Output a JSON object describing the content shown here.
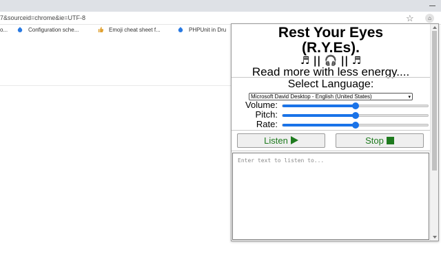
{
  "browser": {
    "url": "7&sourceid=chrome&ie=UTF-8",
    "bookmarks": [
      {
        "label": "o..."
      },
      {
        "label": "Configuration sche..."
      },
      {
        "label": "Emoji cheat sheet f..."
      },
      {
        "label": "PHPUnit in Dru"
      }
    ]
  },
  "popup": {
    "title_line1": "Rest Your Eyes",
    "title_line2": "(R.Y.Es).",
    "music_notes": "♬ || 🎧 || ♬",
    "tagline": "Read more with less energy....",
    "language_label": "Select Language:",
    "voice_selected": "Microsoft David Desktop - English (United States)",
    "sliders": [
      {
        "label": "Volume:",
        "value": 0.5
      },
      {
        "label": "Pitch:",
        "value": 0.5
      },
      {
        "label": "Rate:",
        "value": 0.5
      }
    ],
    "listen_label": "Listen",
    "stop_label": "Stop",
    "text_placeholder": "Enter text to listen to..."
  },
  "colors": {
    "accent": "#1a73e8",
    "button_text": "#1e7a1e"
  }
}
